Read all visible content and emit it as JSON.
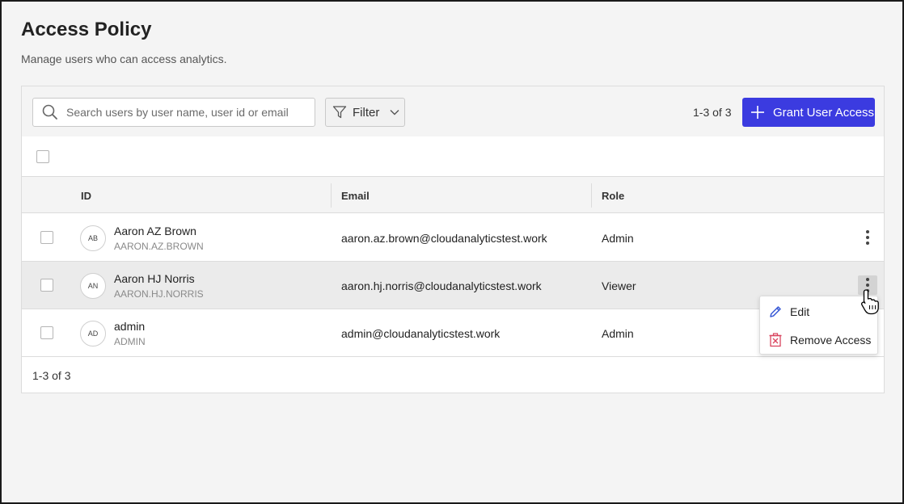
{
  "page": {
    "title": "Access Policy",
    "subtitle": "Manage users who can access analytics."
  },
  "toolbar": {
    "search_placeholder": "Search users by user name, user id or email",
    "filter_label": "Filter",
    "count_text": "1-3 of 3",
    "grant_label": "Grant User Access"
  },
  "table": {
    "columns": [
      "ID",
      "Email",
      "Role"
    ],
    "rows": [
      {
        "initials": "AB",
        "name": "Aaron AZ Brown",
        "user_id": "AARON.AZ.BROWN",
        "email": "aaron.az.brown@cloudanalyticstest.work",
        "role": "Admin"
      },
      {
        "initials": "AN",
        "name": "Aaron HJ Norris",
        "user_id": "AARON.HJ.NORRIS",
        "email": "aaron.hj.norris@cloudanalyticstest.work",
        "role": "Viewer"
      },
      {
        "initials": "AD",
        "name": "admin",
        "user_id": "ADMIN",
        "email": "admin@cloudanalyticstest.work",
        "role": "Admin"
      }
    ],
    "footer_count": "1-3 of 3"
  },
  "context_menu": {
    "items": [
      {
        "label": "Edit",
        "icon": "pencil-icon"
      },
      {
        "label": "Remove Access",
        "icon": "remove-access-icon"
      }
    ]
  },
  "colors": {
    "accent": "#3b3be0",
    "edit_icon": "#3b5bd6",
    "remove_icon": "#d9455f"
  }
}
